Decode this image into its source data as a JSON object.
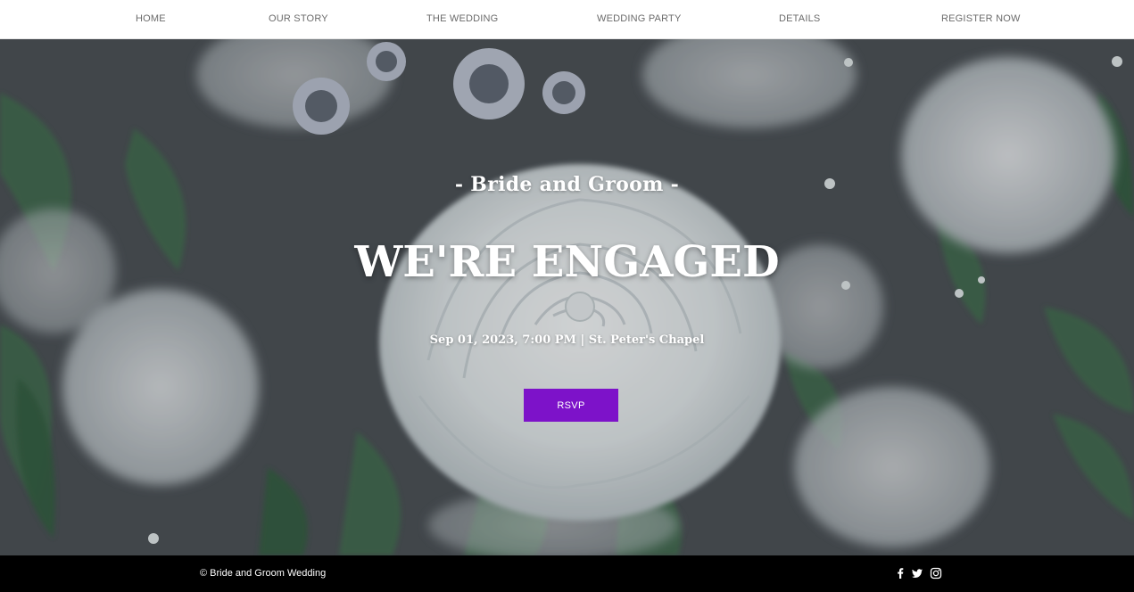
{
  "nav": {
    "items": [
      {
        "label": "HOME"
      },
      {
        "label": "OUR STORY"
      },
      {
        "label": "THE WEDDING"
      },
      {
        "label": "WEDDING PARTY"
      },
      {
        "label": "DETAILS"
      },
      {
        "label": "REGISTER NOW"
      }
    ]
  },
  "hero": {
    "couple": "- Bride and Groom -",
    "headline": "WE'RE ENGAGED",
    "event": "Sep 01, 2023, 7:00 PM | St. Peter's Chapel",
    "rsvp_label": "RSVP",
    "background": "white-roses-photo"
  },
  "footer": {
    "copyright": "© Bride and Groom Wedding",
    "social": [
      "facebook-icon",
      "twitter-icon",
      "instagram-icon"
    ]
  },
  "colors": {
    "accent": "#7d12c9",
    "nav_text": "#6b6b6b",
    "footer_bg": "#000000"
  }
}
